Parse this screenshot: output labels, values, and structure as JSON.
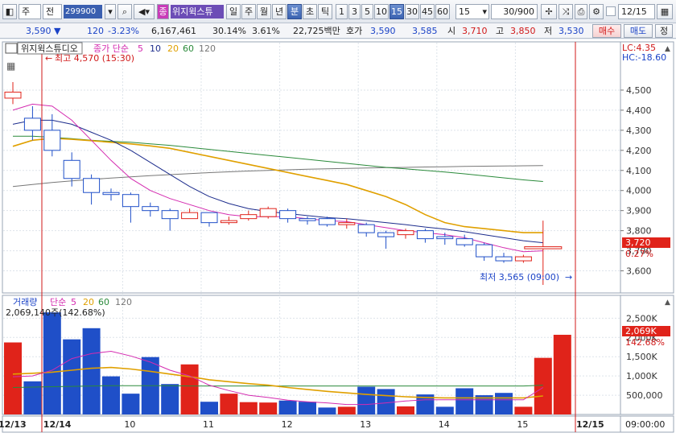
{
  "toolbar": {
    "view_select": "주",
    "prev_label": "전",
    "stock_code": "299900",
    "stock_name": "위지윅스튜",
    "period_tabs": [
      "일",
      "주",
      "월",
      "년",
      "분",
      "초",
      "틱"
    ],
    "selected_tab": "분",
    "minute_buttons": [
      "1",
      "3",
      "5",
      "10",
      "15",
      "30",
      "45",
      "60"
    ],
    "selected_minute": "15",
    "interval_value": "15",
    "count_value": "30/900",
    "date_value": "12/15"
  },
  "infobar": {
    "price": "3,590",
    "change_arrow": "▼",
    "change": "120",
    "change_pct": "-3.23%",
    "volume": "6,167,461",
    "volume_ratio": "30.14%",
    "turnover": "3.61%",
    "amount": "22,725백만",
    "ask_label": "호가",
    "ask_price": "3,590",
    "bid_price": "3,585",
    "open_label": "시",
    "open": "3,710",
    "high_label": "고",
    "high": "3,850",
    "low_label": "저",
    "low": "3,530",
    "buy_button": "매수",
    "sell_button": "매도",
    "more_button": "정"
  },
  "price_panel": {
    "title": "위지윅스튜디오",
    "ma_label": "종가 단순",
    "ma_periods": [
      "5",
      "10",
      "20",
      "60",
      "120"
    ],
    "lc_label": "LC:4.35",
    "hc_label": "HC:-18.60",
    "high_marker": "최고 4,570 (15:30)",
    "low_marker": "최저 3,565 (09:00)",
    "current_price_tag": "3,720",
    "current_pct_tag": "0.27%",
    "y_ticks": [
      "4,500",
      "4,400",
      "4,300",
      "4,200",
      "4,100",
      "4,000",
      "3,900",
      "3,800",
      "3,700",
      "3,600"
    ]
  },
  "volume_panel": {
    "title": "거래량",
    "ma_label": "단순",
    "ma_periods": [
      "5",
      "20",
      "60",
      "120"
    ],
    "info": "2,069,140주(142.68%)",
    "current_volume_tag": "2,069K",
    "current_pct_tag": "142.68%",
    "y_ticks": [
      "2,500K",
      "2,000K",
      "1,500K",
      "1,000K",
      "500,000"
    ]
  },
  "x_axis": {
    "labels": [
      "12/13",
      "12/14",
      "10",
      "11",
      "12",
      "13",
      "14",
      "15",
      "12/15"
    ],
    "time_label": "09:00:00"
  },
  "colors": {
    "up": "#e0231a",
    "down": "#1f4fc8",
    "ma5": "#d42bb0",
    "ma10": "#1c2c8c",
    "ma20": "#e0a000",
    "ma60": "#2a8a3a",
    "ma120": "#777777"
  },
  "chart_data": {
    "type": "candlestick",
    "candles": [
      {
        "o": 4460,
        "h": 4540,
        "l": 4430,
        "c": 4490
      },
      {
        "o": 4360,
        "h": 4420,
        "l": 4250,
        "c": 4300
      },
      {
        "o": 4300,
        "h": 4380,
        "l": 4170,
        "c": 4200
      },
      {
        "o": 4150,
        "h": 4190,
        "l": 4020,
        "c": 4060
      },
      {
        "o": 4060,
        "h": 4080,
        "l": 3930,
        "c": 3990
      },
      {
        "o": 3990,
        "h": 4010,
        "l": 3950,
        "c": 3980
      },
      {
        "o": 3980,
        "h": 3990,
        "l": 3840,
        "c": 3920
      },
      {
        "o": 3920,
        "h": 3940,
        "l": 3870,
        "c": 3900
      },
      {
        "o": 3900,
        "h": 3910,
        "l": 3800,
        "c": 3860
      },
      {
        "o": 3860,
        "h": 3910,
        "l": 3860,
        "c": 3890
      },
      {
        "o": 3890,
        "h": 3890,
        "l": 3820,
        "c": 3840
      },
      {
        "o": 3840,
        "h": 3870,
        "l": 3830,
        "c": 3850
      },
      {
        "o": 3860,
        "h": 3900,
        "l": 3850,
        "c": 3880
      },
      {
        "o": 3870,
        "h": 3920,
        "l": 3860,
        "c": 3910
      },
      {
        "o": 3900,
        "h": 3910,
        "l": 3840,
        "c": 3860
      },
      {
        "o": 3860,
        "h": 3870,
        "l": 3830,
        "c": 3850
      },
      {
        "o": 3860,
        "h": 3870,
        "l": 3820,
        "c": 3830
      },
      {
        "o": 3830,
        "h": 3860,
        "l": 3810,
        "c": 3840
      },
      {
        "o": 3830,
        "h": 3840,
        "l": 3770,
        "c": 3790
      },
      {
        "o": 3790,
        "h": 3800,
        "l": 3710,
        "c": 3770
      },
      {
        "o": 3780,
        "h": 3810,
        "l": 3760,
        "c": 3800
      },
      {
        "o": 3800,
        "h": 3810,
        "l": 3740,
        "c": 3760
      },
      {
        "o": 3770,
        "h": 3790,
        "l": 3730,
        "c": 3760
      },
      {
        "o": 3760,
        "h": 3780,
        "l": 3720,
        "c": 3730
      },
      {
        "o": 3730,
        "h": 3740,
        "l": 3650,
        "c": 3670
      },
      {
        "o": 3670,
        "h": 3690,
        "l": 3640,
        "c": 3650
      },
      {
        "o": 3650,
        "h": 3680,
        "l": 3640,
        "c": 3670
      },
      {
        "o": 3710,
        "h": 3850,
        "l": 3530,
        "c": 3720
      }
    ],
    "ma5": [
      4400,
      4430,
      4420,
      4350,
      4250,
      4150,
      4060,
      4000,
      3960,
      3930,
      3900,
      3880,
      3870,
      3870,
      3870,
      3860,
      3850,
      3845,
      3830,
      3815,
      3800,
      3790,
      3780,
      3765,
      3740,
      3715,
      3695,
      3700
    ],
    "ma10": [
      4330,
      4350,
      4350,
      4330,
      4290,
      4250,
      4200,
      4140,
      4080,
      4020,
      3970,
      3935,
      3910,
      3895,
      3885,
      3875,
      3865,
      3860,
      3850,
      3840,
      3830,
      3818,
      3808,
      3795,
      3780,
      3765,
      3750,
      3740
    ],
    "ma20": [
      4220,
      4250,
      4260,
      4255,
      4248,
      4240,
      4232,
      4222,
      4210,
      4190,
      4170,
      4150,
      4130,
      4110,
      4090,
      4070,
      4050,
      4030,
      4000,
      3970,
      3930,
      3880,
      3840,
      3820,
      3810,
      3800,
      3790,
      3790
    ],
    "ma60": [
      4270,
      4270,
      4265,
      4258,
      4250,
      4245,
      4240,
      4232,
      4225,
      4215,
      4205,
      4195,
      4185,
      4175,
      4165,
      4155,
      4145,
      4135,
      4125,
      4115,
      4108,
      4100,
      4092,
      4083,
      4073,
      4063,
      4053,
      4045
    ],
    "ma120": [
      4020,
      4030,
      4040,
      4048,
      4055,
      4062,
      4068,
      4074,
      4079,
      4084,
      4089,
      4093,
      4097,
      4100,
      4103,
      4106,
      4108,
      4110,
      4112,
      4114,
      4115,
      4117,
      4118,
      4120,
      4121,
      4122,
      4123,
      4124
    ],
    "price_ylim": [
      3530,
      4600
    ],
    "volume": [
      1870,
      860,
      2650,
      1950,
      2240,
      990,
      540,
      1490,
      790,
      1300,
      330,
      540,
      320,
      310,
      360,
      330,
      180,
      200,
      720,
      660,
      210,
      520,
      200,
      680,
      500,
      560,
      200,
      1470
    ],
    "volume_last": 2069,
    "volume_ma5": [
      980,
      1000,
      1150,
      1450,
      1580,
      1640,
      1520,
      1360,
      1150,
      1000,
      760,
      620,
      500,
      440,
      370,
      330,
      300,
      260,
      260,
      300,
      350,
      380,
      380,
      380,
      380,
      380,
      380,
      700
    ],
    "volume_ma20": [
      1050,
      1070,
      1100,
      1150,
      1200,
      1220,
      1180,
      1120,
      1050,
      980,
      900,
      850,
      800,
      760,
      700,
      650,
      600,
      560,
      520,
      490,
      460,
      440,
      430,
      430,
      430,
      430,
      430,
      480
    ],
    "volume_ma60": [
      700,
      710,
      720,
      730,
      740,
      745,
      745,
      745,
      745,
      740,
      740,
      740,
      740,
      740,
      740,
      740,
      740,
      740,
      740,
      740,
      740,
      740,
      740,
      740,
      740,
      740,
      740,
      760
    ],
    "volume_ylim": [
      0,
      2800
    ],
    "volume_unit": "K"
  }
}
